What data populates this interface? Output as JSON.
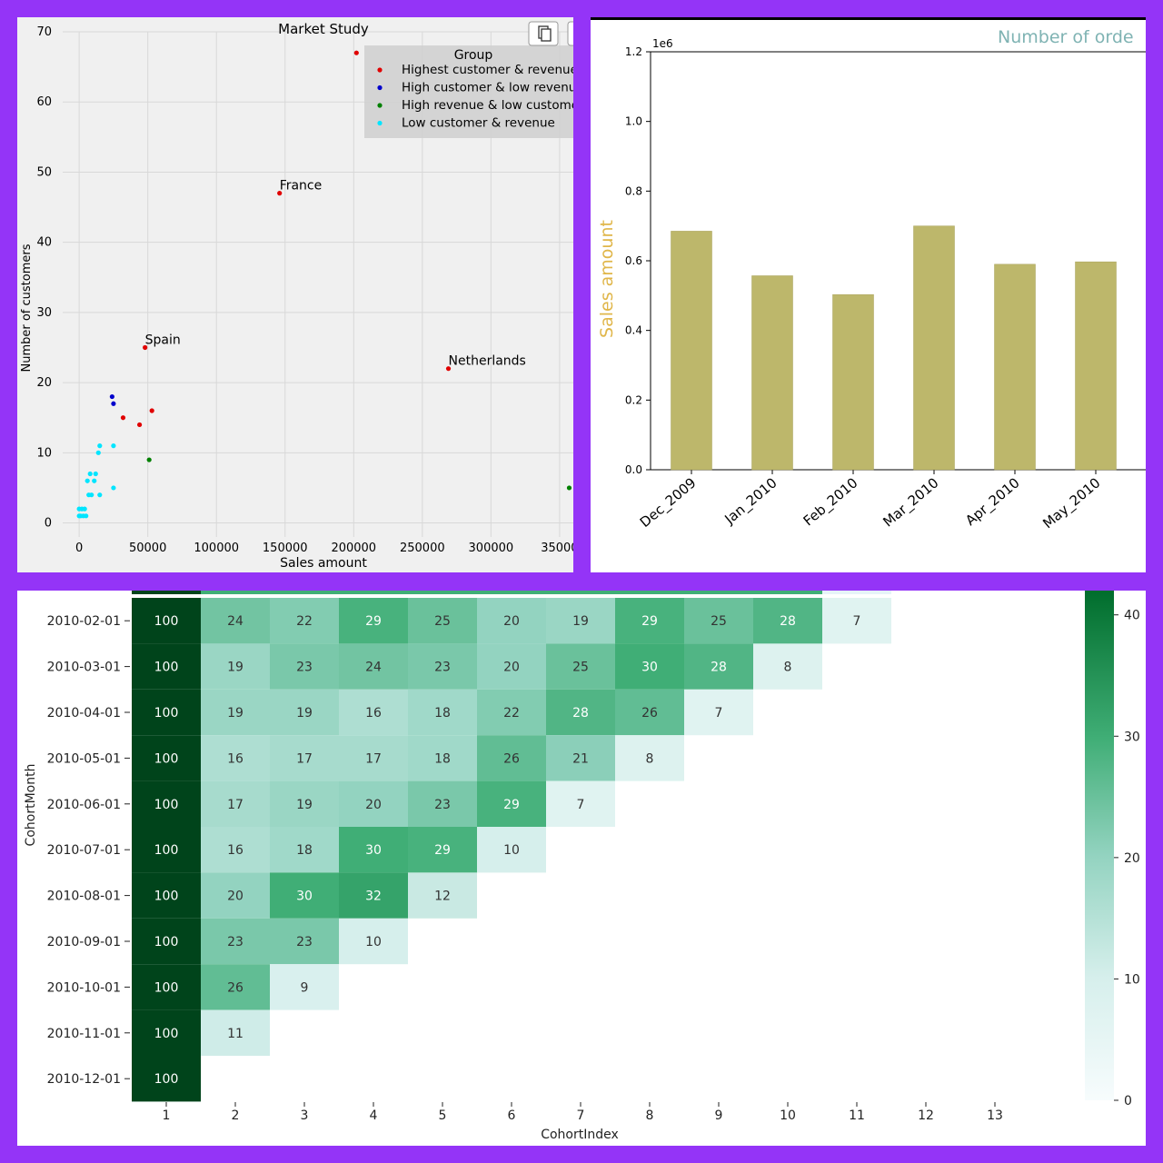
{
  "chart_data": [
    {
      "type": "scatter",
      "title": "Market Study",
      "xlabel": "Sales amount",
      "ylabel": "Number of customers",
      "xlim": [
        -12000,
        360000
      ],
      "ylim": [
        -2,
        70
      ],
      "x_ticks": [
        0,
        50000,
        100000,
        150000,
        200000,
        250000,
        300000,
        350000
      ],
      "x_tick_labels": [
        "0",
        "50000",
        "100000",
        "150000",
        "200000",
        "250000",
        "300000",
        "35000"
      ],
      "y_ticks": [
        0,
        10,
        20,
        30,
        40,
        50,
        60,
        70
      ],
      "grid": true,
      "legend": {
        "title": "Group",
        "position": "top-right",
        "entries": [
          {
            "label": "Highest customer & revenue",
            "color": "#e00000"
          },
          {
            "label": "High customer & low revenu",
            "color": "#0000cc"
          },
          {
            "label": "High revenue & low custome",
            "color": "#008000"
          },
          {
            "label": "Low customer & revenue",
            "color": "#00e5ff"
          }
        ]
      },
      "series": [
        {
          "group": 0,
          "points": [
            [
              202000,
              67
            ],
            [
              146000,
              47
            ],
            [
              48000,
              25
            ],
            [
              269000,
              22
            ],
            [
              32000,
              15
            ],
            [
              44000,
              14
            ],
            [
              53000,
              16
            ]
          ]
        },
        {
          "group": 1,
          "points": [
            [
              24000,
              18
            ],
            [
              25000,
              17
            ]
          ]
        },
        {
          "group": 2,
          "points": [
            [
              51000,
              9
            ],
            [
              357000,
              5
            ]
          ]
        },
        {
          "group": 3,
          "points": [
            [
              15000,
              11
            ],
            [
              25000,
              11
            ],
            [
              14000,
              10
            ],
            [
              8000,
              7
            ],
            [
              12000,
              7
            ],
            [
              6000,
              6
            ],
            [
              11000,
              6
            ],
            [
              7000,
              4
            ],
            [
              9000,
              4
            ],
            [
              15000,
              4
            ],
            [
              25000,
              5
            ],
            [
              0,
              2
            ],
            [
              2000,
              2
            ],
            [
              4000,
              2
            ],
            [
              1000,
              1
            ],
            [
              3000,
              1
            ],
            [
              5000,
              1
            ],
            [
              0,
              1
            ]
          ]
        }
      ],
      "annotations": [
        {
          "text": "France",
          "x": 146000,
          "y": 47
        },
        {
          "text": "Spain",
          "x": 48000,
          "y": 25
        },
        {
          "text": "Netherlands",
          "x": 269000,
          "y": 22
        }
      ]
    },
    {
      "type": "bar",
      "title": "Number of orde",
      "xlabel": "",
      "ylabel": "Sales amount",
      "offset_label": "1e6",
      "categories": [
        "Dec_2009",
        "Jan_2010",
        "Feb_2010",
        "Mar_2010",
        "Apr_2010",
        "May_2010"
      ],
      "values": [
        0.685,
        0.557,
        0.503,
        0.7,
        0.59,
        0.597
      ],
      "ylim": [
        0,
        1.2
      ],
      "y_ticks": [
        "0.0",
        "0.2",
        "0.4",
        "0.6",
        "0.8",
        "1.0",
        "1.2"
      ],
      "bar_color": "#bdb76b",
      "title_color": "#7fb3b3",
      "ylabel_color": "#e0b64a"
    },
    {
      "type": "heatmap",
      "xlabel": "CohortIndex",
      "ylabel": "CohortMonth",
      "columns": [
        "1",
        "2",
        "3",
        "4",
        "5",
        "6",
        "7",
        "8",
        "9",
        "10",
        "11",
        "12",
        "13"
      ],
      "rows": [
        "2010-02-01",
        "2010-03-01",
        "2010-04-01",
        "2010-05-01",
        "2010-06-01",
        "2010-07-01",
        "2010-08-01",
        "2010-09-01",
        "2010-10-01",
        "2010-11-01",
        "2010-12-01"
      ],
      "values": [
        [
          100,
          24,
          22,
          29,
          25,
          20,
          19,
          29,
          25,
          28,
          7
        ],
        [
          100,
          19,
          23,
          24,
          23,
          20,
          25,
          30,
          28,
          8
        ],
        [
          100,
          19,
          19,
          16,
          18,
          22,
          28,
          26,
          7
        ],
        [
          100,
          16,
          17,
          17,
          18,
          26,
          21,
          8
        ],
        [
          100,
          17,
          19,
          20,
          23,
          29,
          7
        ],
        [
          100,
          16,
          18,
          30,
          29,
          10
        ],
        [
          100,
          20,
          30,
          32,
          12
        ],
        [
          100,
          23,
          23,
          10
        ],
        [
          100,
          26,
          9
        ],
        [
          100,
          11
        ],
        [
          100
        ]
      ],
      "colorbar_ticks": [
        "0",
        "10",
        "20",
        "30",
        "40"
      ],
      "vmin": 0,
      "vmax": 42,
      "colormap": "BuGn"
    }
  ]
}
